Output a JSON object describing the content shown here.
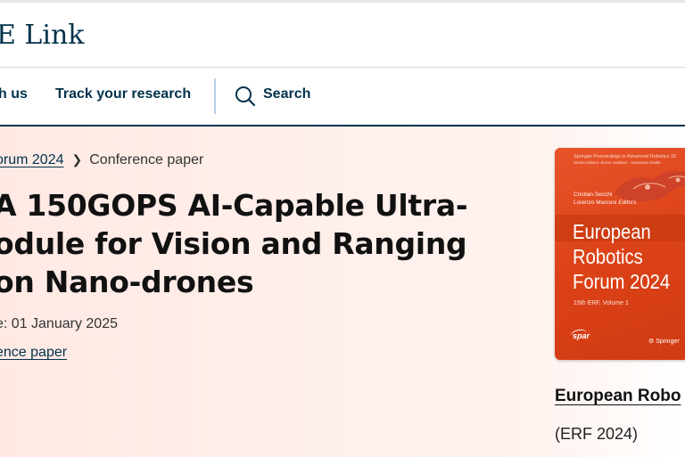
{
  "header": {
    "logo": "E Link"
  },
  "nav": {
    "items": [
      {
        "label": "h us"
      },
      {
        "label": "Track your research"
      }
    ],
    "search_label": "Search"
  },
  "breadcrumb": {
    "parent": "orum 2024",
    "current": "Conference paper"
  },
  "article": {
    "title_lines": [
      "A 150GOPS AI-Capable Ultra-",
      "odule for Vision and Ranging",
      "on Nano-drones"
    ],
    "pub_date": "e: 01 January 2025",
    "content_type": "ence paper"
  },
  "book": {
    "cover": {
      "series": "Springer Proceedings in Advanced Robotics 32",
      "series_editors": "Series Editors: Bruno Siciliano · Oussama Khatib",
      "editors": [
        "Cristian Secchi",
        "Lorenzo Marconi"
      ],
      "editors_suffix": "Editors",
      "title_lines": [
        "European",
        "Robotics",
        "Forum 2024"
      ],
      "subtitle": "15th ERF, Volume 1",
      "logo_text": "spar",
      "publisher": "Springer"
    },
    "title": "European Robo",
    "abbr": "(ERF 2024)"
  },
  "colors": {
    "brand_navy": "#01324b",
    "hero_bg": "#ffe9e4",
    "cover_orange": "#dc4217"
  },
  "icons": {
    "search": "search-icon",
    "chevron": "chevron-right-icon"
  }
}
